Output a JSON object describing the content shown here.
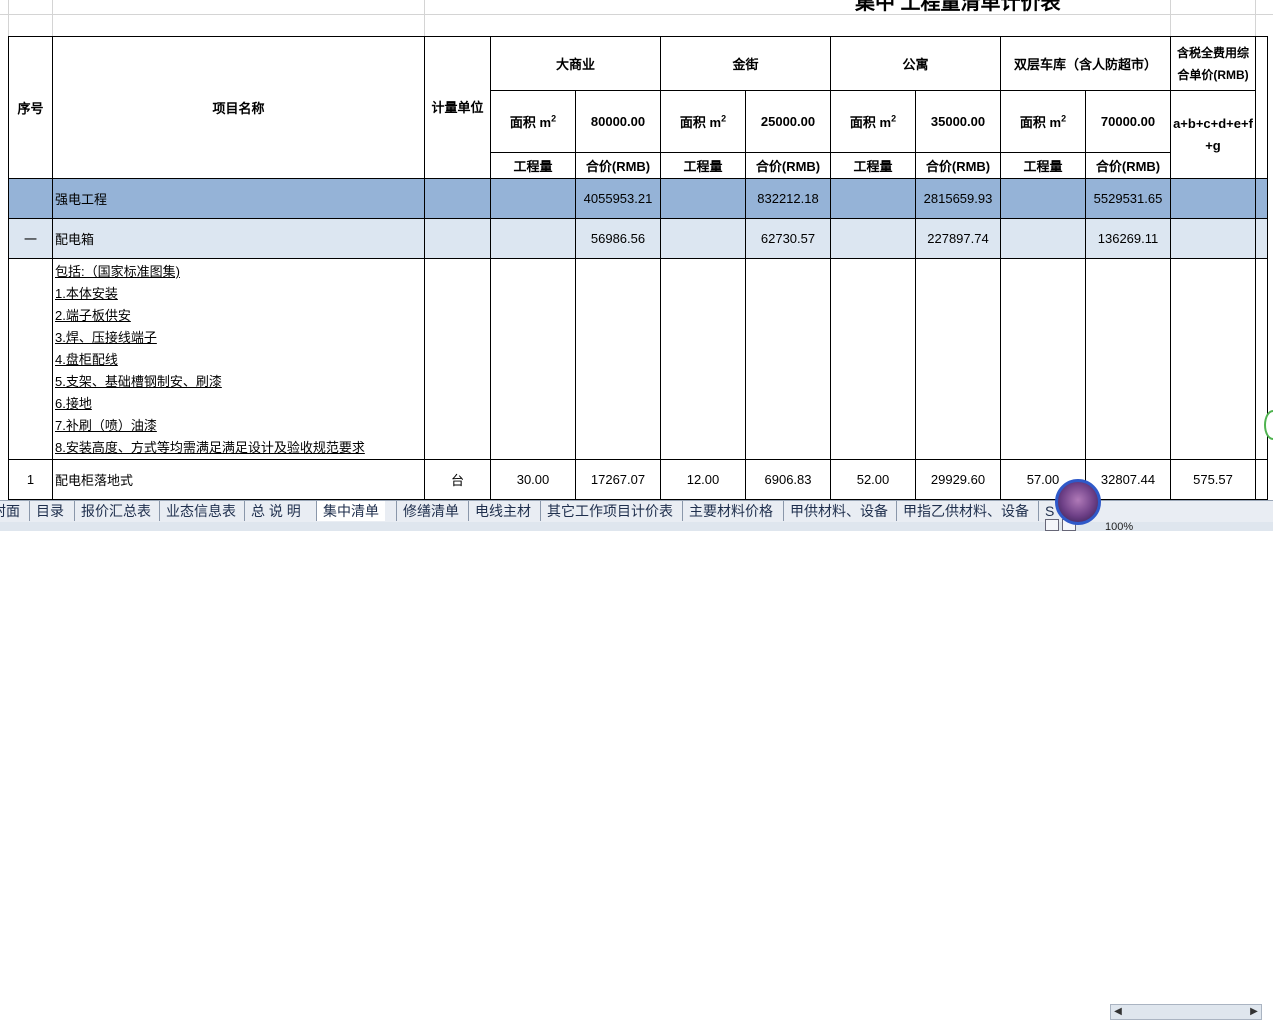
{
  "title": "集中 工程量清单计价表",
  "header": {
    "seq": "序号",
    "name": "项目名称",
    "unit": "计量单位",
    "groups": [
      "大商业",
      "金街",
      "公寓",
      "双层车库（含人防超市）"
    ],
    "area_label": "面积 m",
    "area_sup": "2",
    "areas": [
      "80000.00",
      "25000.00",
      "35000.00",
      "70000.00"
    ],
    "qty_label": "工程量",
    "price_label": "合价(RMB)",
    "unit_price_label": "含税全费用综合单价(RMB)",
    "formula": "a+b+c+d+e+f+g"
  },
  "rows": {
    "strong": {
      "name": "强电工程",
      "totals": [
        "4055953.21",
        "832212.18",
        "2815659.93",
        "5529531.65"
      ]
    },
    "box": {
      "seq": "一",
      "name": "配电箱",
      "totals": [
        "56986.56",
        "62730.57",
        "227897.74",
        "136269.11"
      ]
    },
    "desc_lines": [
      "包括:（国家标准图集)",
      "1.本体安装",
      "2.端子板供安",
      "3.焊、压接线端子",
      "4.盘柜配线",
      "5.支架、基础槽钢制安、刷漆",
      "6.接地",
      "7.补刷（喷）油漆",
      "8.安装高度、方式等均需满足满足设计及验收规范要求"
    ],
    "item1": {
      "seq": "1",
      "name": "配电柜落地式",
      "unit": "台",
      "qty1": "30.00",
      "price1": "17267.07",
      "qty2": "12.00",
      "price2": "6906.83",
      "qty3": "52.00",
      "price3": "29929.60",
      "qty4": "57.00",
      "price4": "32807.44",
      "unit_price": "575.57"
    }
  },
  "tabs": [
    "封面",
    "目录",
    "报价汇总表",
    "业态信息表",
    "总 说 明",
    "集中清单",
    "修缮清单",
    "电线主材",
    "其它工作项目计价表",
    "主要材料价格",
    "甲供材料、设备",
    "甲指乙供材料、设备",
    "S"
  ],
  "active_tab": "集中清单",
  "zoom": "100%",
  "colors": {
    "strong_row": "#95b3d7",
    "box_row": "#dce6f1"
  }
}
